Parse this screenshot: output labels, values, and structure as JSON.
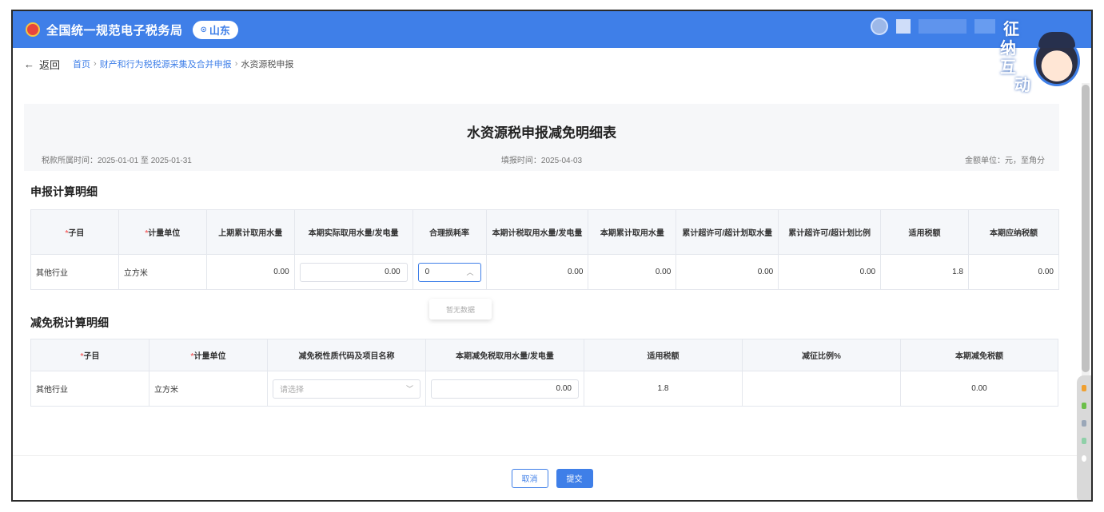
{
  "app": {
    "title": "全国统一规范电子税务局",
    "region": "山东",
    "mascot_text": [
      "征",
      "纳",
      "互",
      "动"
    ]
  },
  "nav": {
    "back_label": "返回",
    "breadcrumbs": [
      "首页",
      "财产和行为税税源采集及合并申报",
      "水资源税申报"
    ]
  },
  "form": {
    "title": "水资源税申报减免明细表",
    "period": "税款所属时间：2025-01-01 至 2025-01-31",
    "fill_date": "填报时间：2025-04-03",
    "unit": "金额单位：元，至角分"
  },
  "section1": {
    "title": "申报计算明细",
    "headers": [
      "子目",
      "计量单位",
      "上期累计取用水量",
      "本期实际取用水量/发电量",
      "合理损耗率",
      "本期计税取用水量/发电量",
      "本期累计取用水量",
      "累计超许可/超计划取水量",
      "累计超许可/超计划比例",
      "适用税额",
      "本期应纳税额"
    ],
    "row": {
      "item": "其他行业",
      "unit": "立方米",
      "prev_cum": "0.00",
      "actual": "0.00",
      "loss_rate": "0",
      "taxable": "0.00",
      "cum_period": "0.00",
      "over_qty": "0.00",
      "over_ratio": "0.00",
      "rate": "1.8",
      "tax": "0.00"
    },
    "dropdown_empty": "暂无数据"
  },
  "section2": {
    "title": "减免税计算明细",
    "headers": [
      "子目",
      "计量单位",
      "减免税性质代码及项目名称",
      "本期减免税取用水量/发电量",
      "适用税额",
      "减征比例%",
      "本期减免税额"
    ],
    "row": {
      "item": "其他行业",
      "unit": "立方米",
      "code_placeholder": "请选择",
      "qty": "0.00",
      "rate": "1.8",
      "ratio": "",
      "amount": "0.00"
    }
  },
  "footer": {
    "cancel_label": "取消",
    "submit_label": "提交"
  },
  "colors": {
    "brand": "#3f7fe8",
    "required": "#f56c6c"
  }
}
